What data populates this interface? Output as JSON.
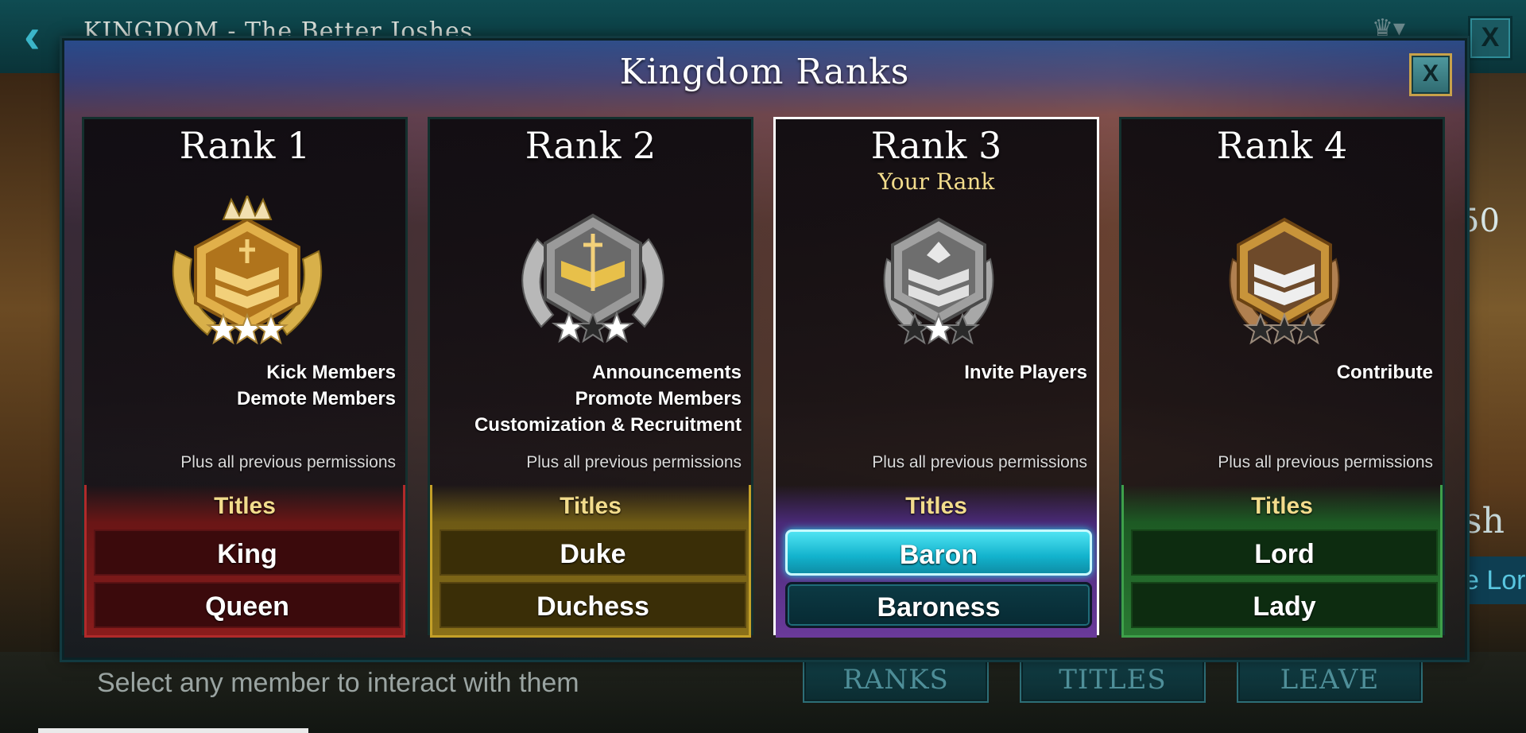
{
  "background": {
    "kingdom_title": "KINGDOM - The Better Joshes",
    "right_number": "50",
    "right_ash": "sh",
    "right_lord": "e Lord",
    "hint": "Select any member to interact with them",
    "buttons": [
      "RANKS",
      "TITLES",
      "LEAVE"
    ],
    "close_label": "X"
  },
  "modal": {
    "title": "Kingdom Ranks",
    "close_label": "X"
  },
  "ranks": [
    {
      "name": "Rank 1",
      "your_rank": "",
      "permissions": [
        "Kick Members",
        "Demote Members"
      ],
      "plus_text": "Plus all previous permissions",
      "titles_label": "Titles",
      "titles": [
        "King",
        "Queen"
      ],
      "color": "#8a1c1c",
      "stars_filled": 3
    },
    {
      "name": "Rank 2",
      "your_rank": "",
      "permissions": [
        "Announcements",
        "Promote Members",
        "Customization & Recruitment"
      ],
      "plus_text": "Plus all previous permissions",
      "titles_label": "Titles",
      "titles": [
        "Duke",
        "Duchess"
      ],
      "color": "#8a7019",
      "stars_filled": 2
    },
    {
      "name": "Rank 3",
      "your_rank": "Your Rank",
      "permissions": [
        "Invite Players"
      ],
      "plus_text": "Plus all previous permissions",
      "titles_label": "Titles",
      "titles": [
        "Baron",
        "Baroness"
      ],
      "color": "#6a3a9a",
      "stars_filled": 1
    },
    {
      "name": "Rank 4",
      "your_rank": "",
      "permissions": [
        "Contribute"
      ],
      "plus_text": "Plus all previous permissions",
      "titles_label": "Titles",
      "titles": [
        "Lord",
        "Lady"
      ],
      "color": "#2a7a33",
      "stars_filled": 0
    }
  ]
}
